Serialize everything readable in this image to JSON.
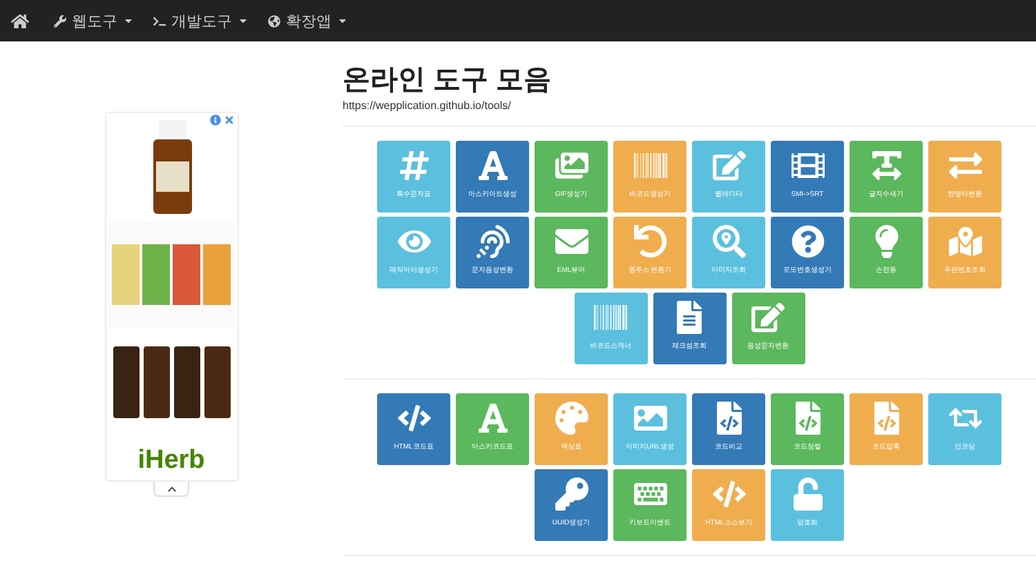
{
  "navbar": {
    "items": [
      {
        "label": "웹도구"
      },
      {
        "label": "개발도구"
      },
      {
        "label": "확장앱"
      }
    ]
  },
  "ad": {
    "logo": "iHerb"
  },
  "header": {
    "title": "온라인 도구 모음",
    "url": "https://wepplication.github.io/tools/"
  },
  "sections": [
    {
      "tools": [
        {
          "label": "특수문자표",
          "color": "#5bc0de"
        },
        {
          "label": "아스키아트생성",
          "color": "#337ab7"
        },
        {
          "label": "GIF생성기",
          "color": "#5cb85c"
        },
        {
          "label": "바코드생성기",
          "color": "#f0ad4e"
        },
        {
          "label": "웹에디터",
          "color": "#5bc0de"
        },
        {
          "label": "SMI->SRT",
          "color": "#337ab7"
        },
        {
          "label": "글자수세기",
          "color": "#5cb85c"
        },
        {
          "label": "한영타변환",
          "color": "#f0ad4e"
        },
        {
          "label": "매직아이생성기",
          "color": "#5bc0de"
        },
        {
          "label": "문자음성변환",
          "color": "#337ab7"
        },
        {
          "label": "EML뷰어",
          "color": "#5cb85c"
        },
        {
          "label": "원주소 변환기",
          "color": "#f0ad4e"
        },
        {
          "label": "이미지조회",
          "color": "#5bc0de"
        },
        {
          "label": "로또번호생성기",
          "color": "#337ab7"
        },
        {
          "label": "손전등",
          "color": "#5cb85c"
        },
        {
          "label": "우편번호조회",
          "color": "#f0ad4e"
        },
        {
          "label": "바코드스캐너",
          "color": "#5bc0de"
        },
        {
          "label": "체크섬조회",
          "color": "#337ab7"
        },
        {
          "label": "음성문자변환",
          "color": "#5cb85c"
        }
      ]
    },
    {
      "tools": [
        {
          "label": "HTML코드표",
          "color": "#337ab7"
        },
        {
          "label": "아스키코드표",
          "color": "#5cb85c"
        },
        {
          "label": "색상표",
          "color": "#f0ad4e"
        },
        {
          "label": "이미지URL생성",
          "color": "#5bc0de"
        },
        {
          "label": "코드비교",
          "color": "#337ab7"
        },
        {
          "label": "코드정렬",
          "color": "#5cb85c"
        },
        {
          "label": "코드압축",
          "color": "#f0ad4e"
        },
        {
          "label": "인코딩",
          "color": "#5bc0de"
        },
        {
          "label": "UUID생성기",
          "color": "#337ab7"
        },
        {
          "label": "키보드이벤트",
          "color": "#5cb85c"
        },
        {
          "label": "HTML소스보기",
          "color": "#f0ad4e"
        },
        {
          "label": "암호화",
          "color": "#5bc0de"
        }
      ]
    }
  ]
}
